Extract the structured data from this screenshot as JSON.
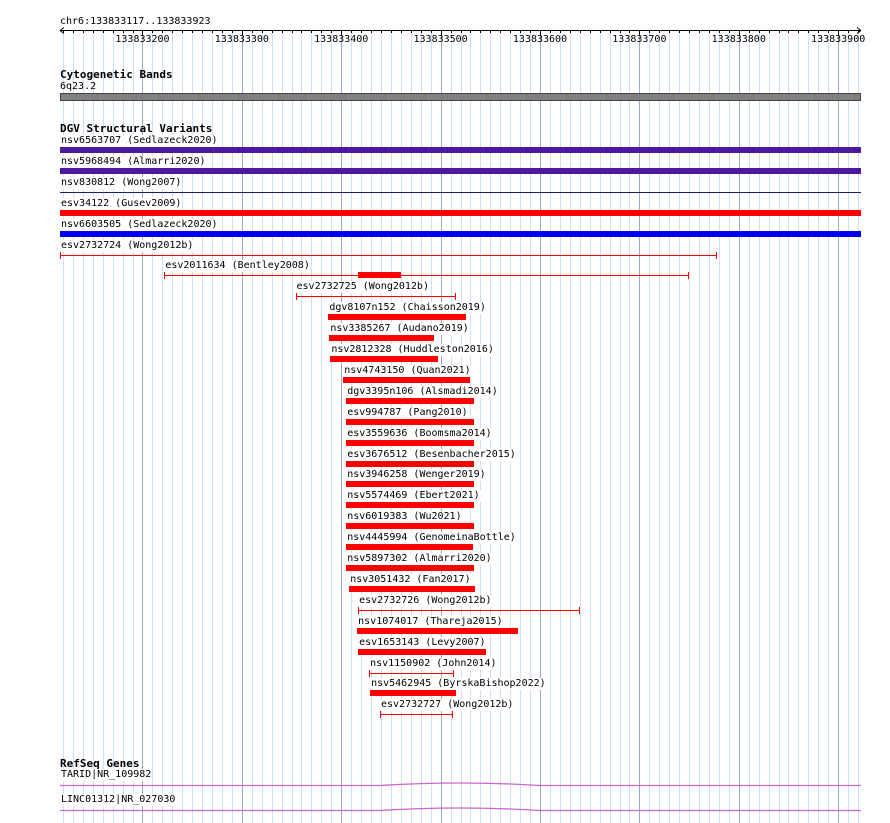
{
  "ruler": {
    "coordinate_label": "chr6:133833117..133833923",
    "tick_labels": [
      "133833200",
      "133833300",
      "133833400",
      "133833500",
      "133833600",
      "133833700",
      "133833800",
      "133833900"
    ]
  },
  "cytobands": {
    "title": "Cytogenetic Bands",
    "band_label": "6q23.2",
    "color": "#808080"
  },
  "dgv": {
    "title": "DGV Structural Variants",
    "features": [
      {
        "label": "nsv6563707 (Sedlazeck2020)",
        "start": 133833117,
        "end": 133833923,
        "style": "thick",
        "color": "#4b1aa0"
      },
      {
        "label": "nsv5968494 (Almarri2020)",
        "start": 133833117,
        "end": 133833923,
        "style": "thick",
        "color": "#4b1aa0"
      },
      {
        "label": "nsv830812 (Wong2007)",
        "start": 133833117,
        "end": 133833923,
        "style": "thin",
        "color": "#1a1a80"
      },
      {
        "label": "esv34122 (Gusev2009)",
        "start": 133833117,
        "end": 133833923,
        "style": "thick",
        "color": "#ff0000"
      },
      {
        "label": "nsv6603505 (Sedlazeck2020)",
        "start": 133833117,
        "end": 133833923,
        "style": "thick",
        "color": "#0000ee"
      },
      {
        "label": "esv2732724 (Wong2012b)",
        "start": 133833117,
        "end": 133833778,
        "style": "line",
        "color": "#ff0000"
      },
      {
        "label": "esv2011634 (Bentley2008)",
        "start": 133833222,
        "end": 133833750,
        "style": "line",
        "color": "#ff0000",
        "inner_start": 133833417,
        "inner_end": 133833460
      },
      {
        "label": "esv2732725 (Wong2012b)",
        "start": 133833354,
        "end": 133833515,
        "style": "line",
        "color": "#ff0000"
      },
      {
        "label": "dgv8107n152 (Chaisson2019)",
        "start": 133833387,
        "end": 133833526,
        "style": "thick",
        "color": "#ff0000"
      },
      {
        "label": "nsv3385267 (Audano2019)",
        "start": 133833388,
        "end": 133833493,
        "style": "thick",
        "color": "#ff0000"
      },
      {
        "label": "nsv2812328 (Huddleston2016)",
        "start": 133833389,
        "end": 133833497,
        "style": "thick",
        "color": "#ff0000"
      },
      {
        "label": "nsv4743150 (Quan2021)",
        "start": 133833402,
        "end": 133833530,
        "style": "thick",
        "color": "#ff0000"
      },
      {
        "label": "dgv3395n106 (Alsmadi2014)",
        "start": 133833405,
        "end": 133833534,
        "style": "thick",
        "color": "#ff0000"
      },
      {
        "label": "esv994787 (Pang2010)",
        "start": 133833405,
        "end": 133833534,
        "style": "thick",
        "color": "#ff0000"
      },
      {
        "label": "esv3559636 (Boomsma2014)",
        "start": 133833405,
        "end": 133833534,
        "style": "thick",
        "color": "#ff0000"
      },
      {
        "label": "esv3676512 (Besenbacher2015)",
        "start": 133833405,
        "end": 133833534,
        "style": "thick",
        "color": "#ff0000"
      },
      {
        "label": "nsv3946258 (Wenger2019)",
        "start": 133833405,
        "end": 133833534,
        "style": "thick",
        "color": "#ff0000"
      },
      {
        "label": "nsv5574469 (Ebert2021)",
        "start": 133833405,
        "end": 133833534,
        "style": "thick",
        "color": "#ff0000"
      },
      {
        "label": "nsv6019383 (Wu2021)",
        "start": 133833405,
        "end": 133833534,
        "style": "thick",
        "color": "#ff0000"
      },
      {
        "label": "nsv4445994 (GenomeinaBottle)",
        "start": 133833405,
        "end": 133833533,
        "style": "thick",
        "color": "#ff0000"
      },
      {
        "label": "nsv5897302 (Almarri2020)",
        "start": 133833405,
        "end": 133833534,
        "style": "thick",
        "color": "#ff0000"
      },
      {
        "label": "nsv3051432 (Fan2017)",
        "start": 133833408,
        "end": 133833535,
        "style": "thick",
        "color": "#ff0000"
      },
      {
        "label": "esv2732726 (Wong2012b)",
        "start": 133833417,
        "end": 133833640,
        "style": "line",
        "color": "#ff0000"
      },
      {
        "label": "nsv1074017 (Thareja2015)",
        "start": 133833416,
        "end": 133833578,
        "style": "thick",
        "color": "#ff0000"
      },
      {
        "label": "esv1653143 (Levy2007)",
        "start": 133833417,
        "end": 133833546,
        "style": "thick",
        "color": "#ff0000"
      },
      {
        "label": "nsv1150902 (John2014)",
        "start": 133833428,
        "end": 133833513,
        "style": "line",
        "color": "#ff0000"
      },
      {
        "label": "nsv5462945 (ByrskaBishop2022)",
        "start": 133833429,
        "end": 133833515,
        "style": "thick",
        "color": "#ff0000"
      },
      {
        "label": "esv2732727 (Wong2012b)",
        "start": 133833439,
        "end": 133833512,
        "style": "line",
        "color": "#ff0000"
      }
    ]
  },
  "refseq": {
    "title": "RefSeq Genes",
    "genes": [
      {
        "label": "TARID|NR_109982",
        "color": "#cc66cc"
      },
      {
        "label": "LINC01312|NR_027030",
        "color": "#cc66cc"
      }
    ]
  }
}
